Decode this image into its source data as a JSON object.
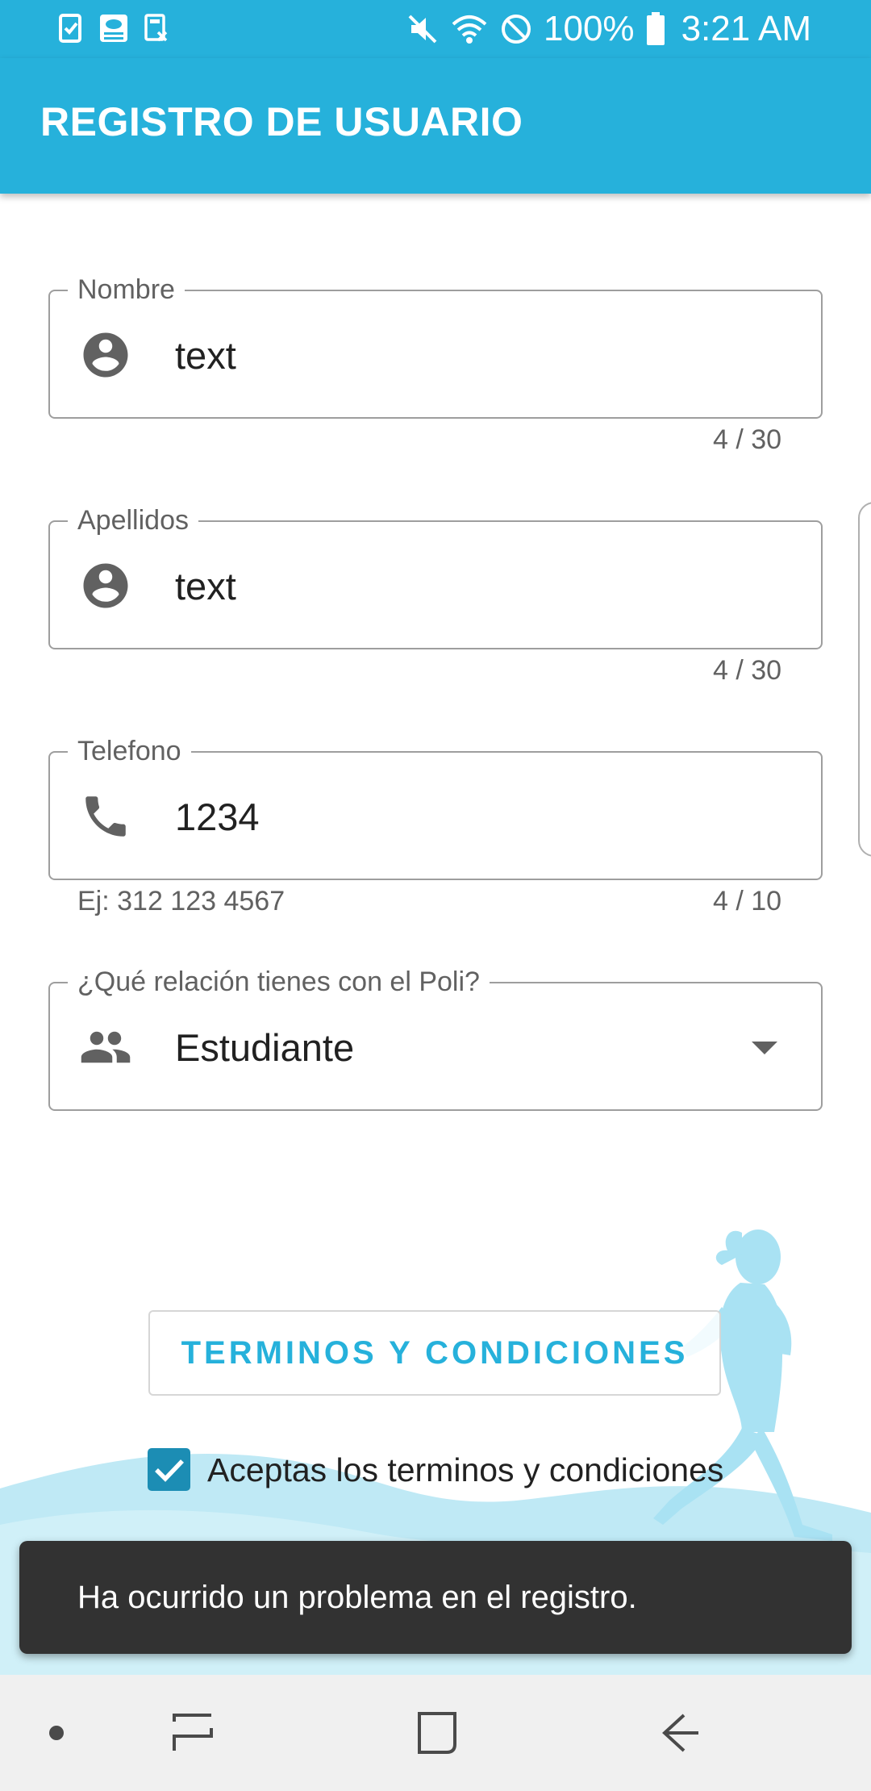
{
  "status_bar": {
    "battery": "100%",
    "time": "3:21 AM",
    "icons": [
      "task-check-icon",
      "weather-app-icon",
      "calculator-icon",
      "mute-icon",
      "wifi-icon",
      "do-not-disturb-icon",
      "battery-icon"
    ]
  },
  "app_bar": {
    "title": "REGISTRO DE USUARIO"
  },
  "form": {
    "nombre": {
      "label": "Nombre",
      "value": "text",
      "counter": "4 / 30",
      "icon": "account-circle-icon"
    },
    "apellidos": {
      "label": "Apellidos",
      "value": "text",
      "counter": "4 / 30",
      "icon": "account-circle-icon"
    },
    "telefono": {
      "label": "Telefono",
      "value": "1234",
      "helper": "Ej: 312 123 4567",
      "counter": "4 / 10",
      "icon": "phone-icon"
    },
    "relacion": {
      "label": "¿Qué relación tienes con el Poli?",
      "value": "Estudiante",
      "icon": "people-icon"
    }
  },
  "terms_button": {
    "label": "TERMINOS Y CONDICIONES"
  },
  "accept_terms": {
    "label": "Aceptas los terminos y condiciones",
    "checked": true
  },
  "snackbar": {
    "message": "Ha ocurrido un problema en el registro."
  },
  "nav_bar": {
    "icons": [
      "dot-icon",
      "recent-apps-icon",
      "home-icon",
      "back-icon"
    ]
  },
  "colors": {
    "primary": "#26b1db",
    "checkbox": "#1c8db4",
    "snackbar": "#323232",
    "wave": "#bfe9f5",
    "runner": "#a9e2f3"
  }
}
